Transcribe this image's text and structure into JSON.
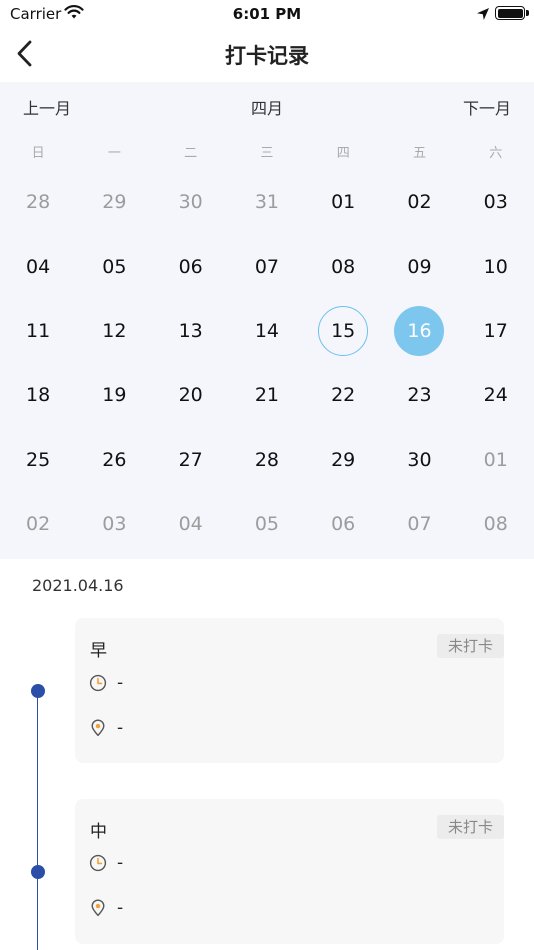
{
  "status_bar": {
    "carrier": "Carrier",
    "time": "6:01 PM",
    "icons": [
      "wifi-icon",
      "location-arrow-icon",
      "battery-icon"
    ]
  },
  "nav": {
    "title": "打卡记录",
    "back_icon": "chevron-left-icon"
  },
  "calendar": {
    "prev_label": "上一月",
    "month_title": "四月",
    "next_label": "下一月",
    "weekdays": [
      "日",
      "一",
      "二",
      "三",
      "四",
      "五",
      "六"
    ],
    "weeks": [
      [
        "28",
        "29",
        "30",
        "31",
        "01",
        "02",
        "03"
      ],
      [
        "04",
        "05",
        "06",
        "07",
        "08",
        "09",
        "10"
      ],
      [
        "11",
        "12",
        "13",
        "14",
        "15",
        "16",
        "17"
      ],
      [
        "18",
        "19",
        "20",
        "21",
        "22",
        "23",
        "24"
      ],
      [
        "25",
        "26",
        "27",
        "28",
        "29",
        "30",
        "01"
      ],
      [
        "02",
        "03",
        "04",
        "05",
        "06",
        "07",
        "08"
      ]
    ],
    "today": "15",
    "selected": "16",
    "colors": {
      "background": "#f4f6fb",
      "today_ring": "#6ec1ea",
      "selected_fill": "#7dc7ef"
    }
  },
  "records": {
    "date": "2021.04.16",
    "timeline_color": "#2b4fa8",
    "cards": [
      {
        "label": "早",
        "status": "未打卡",
        "time": "-",
        "location": "-",
        "time_icon": "clock-icon",
        "location_icon": "location-pin-icon"
      },
      {
        "label": "中",
        "status": "未打卡",
        "time": "-",
        "location": "-",
        "time_icon": "clock-icon",
        "location_icon": "location-pin-icon"
      }
    ]
  }
}
